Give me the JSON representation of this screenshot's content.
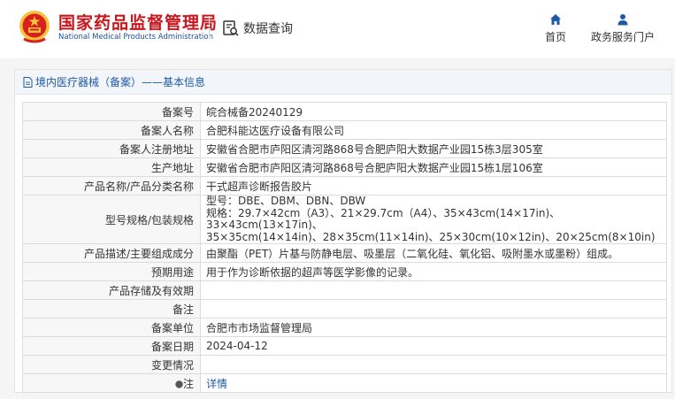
{
  "header": {
    "title_cn": "国家药品监督管理局",
    "title_en": "National Medical Products Administration",
    "data_query_label": "数据查询",
    "nav": [
      {
        "label": "首页",
        "icon": "home-icon"
      },
      {
        "label": "政务服务门户",
        "icon": "user-icon"
      }
    ]
  },
  "breadcrumb": {
    "text": "境内医疗器械（备案）——基本信息",
    "icon": "document-icon"
  },
  "record": {
    "rows": [
      {
        "key": "备案号",
        "value": "皖合械备20240129"
      },
      {
        "key": "备案人名称",
        "value": "合肥科能达医疗设备有限公司"
      },
      {
        "key": "备案人注册地址",
        "value": "安徽省合肥市庐阳区清河路868号合肥庐阳大数据产业园15栋3层305室"
      },
      {
        "key": "生产地址",
        "value": "安徽省合肥市庐阳区清河路868号合肥庐阳大数据产业园15栋1层106室"
      },
      {
        "key": "产品名称/产品分类名称",
        "value": "干式超声诊断报告胶片"
      },
      {
        "key": "型号规格/包装规格",
        "lines": [
          "型号：DBE、DBM、DBN、DBW",
          "规格：29.7×42cm（A3）、21×29.7cm（A4）、35×43cm(14×17in)、33×43cm(13×17in)、",
          "35×35cm(14×14in)、28×35cm(11×14in)、25×30cm(10×12in)、20×25cm(8×10in)"
        ]
      },
      {
        "key": "产品描述/主要组成成分",
        "value": "由聚酯（PET）片基与防静电层、吸墨层（二氧化硅、氧化铝、吸附墨水或墨粉）组成。"
      },
      {
        "key": "预期用途",
        "value": "用于作为诊断依据的超声等医学影像的记录。"
      },
      {
        "key": "产品存储及有效期",
        "value": ""
      },
      {
        "key": "备注",
        "value": ""
      },
      {
        "key": "备案单位",
        "value": "合肥市市场监督管理局"
      },
      {
        "key": "备案日期",
        "value": "2024-04-12"
      },
      {
        "key": "变更情况",
        "value": ""
      },
      {
        "key": "注",
        "value": "详情",
        "key_icon": "info-icon"
      }
    ]
  },
  "colors": {
    "brand_red": "#c8161d",
    "link_blue": "#1f5aa6"
  }
}
